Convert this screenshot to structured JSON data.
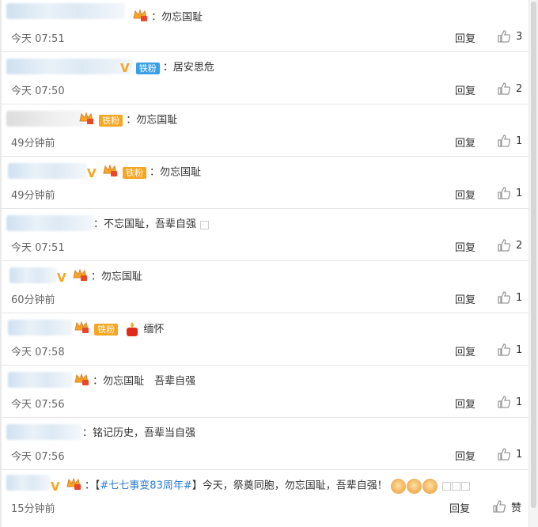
{
  "comments": [
    {
      "text": "：勿忘国耻",
      "time": "今天 07:51",
      "likes": "3"
    },
    {
      "fan": "铁粉",
      "text": "：居安思危",
      "time": "今天 07:50",
      "likes": "2"
    },
    {
      "fan": "铁粉",
      "text": "：勿忘国耻",
      "time": "49分钟前",
      "likes": "1"
    },
    {
      "fan": "铁粉",
      "text": "：勿忘国耻",
      "time": "49分钟前",
      "likes": "1"
    },
    {
      "text": "：不忘国耻，吾辈自强",
      "time": "今天 07:51",
      "likes": "2"
    },
    {
      "text": "：勿忘国耻",
      "time": "60分钟前",
      "likes": "1"
    },
    {
      "fan": "铁粉",
      "text": "缅怀",
      "time": "今天 07:58",
      "likes": "1"
    },
    {
      "text": "：勿忘国耻　吾辈自强",
      "time": "今天 07:56",
      "likes": "1"
    },
    {
      "text": "：铭记历史，吾辈当自强",
      "time": "今天 07:56",
      "likes": "1"
    },
    {
      "topic": "#七七事变83周年#",
      "text_before": "：【",
      "text_after": "】今天，祭奠同胞，勿忘国耻，吾辈自强！",
      "time": "15分钟前",
      "likes": "赞"
    }
  ],
  "reply_label": "回复",
  "vip_mark": "V"
}
